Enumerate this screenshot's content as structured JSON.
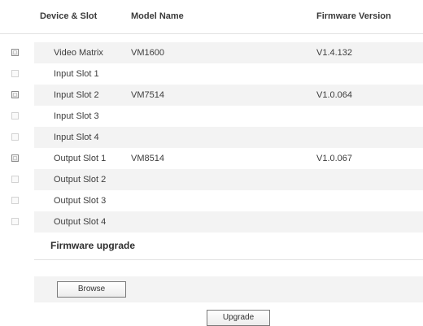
{
  "table": {
    "headers": {
      "device_slot": "Device & Slot",
      "model_name": "Model Name",
      "firmware_version": "Firmware Version"
    },
    "rows": [
      {
        "device": "Video Matrix",
        "model": "VM1600",
        "firmware": "V1.4.132",
        "checkbox_enabled": true
      },
      {
        "device": "Input Slot 1",
        "model": "",
        "firmware": "",
        "checkbox_enabled": false
      },
      {
        "device": "Input Slot 2",
        "model": "VM7514",
        "firmware": "V1.0.064",
        "checkbox_enabled": true
      },
      {
        "device": "Input Slot 3",
        "model": "",
        "firmware": "",
        "checkbox_enabled": false
      },
      {
        "device": "Input Slot 4",
        "model": "",
        "firmware": "",
        "checkbox_enabled": false
      },
      {
        "device": "Output Slot 1",
        "model": "VM8514",
        "firmware": "V1.0.067",
        "checkbox_enabled": true
      },
      {
        "device": "Output Slot 2",
        "model": "",
        "firmware": "",
        "checkbox_enabled": false
      },
      {
        "device": "Output Slot 3",
        "model": "",
        "firmware": "",
        "checkbox_enabled": false
      },
      {
        "device": "Output Slot 4",
        "model": "",
        "firmware": "",
        "checkbox_enabled": false
      }
    ]
  },
  "firmware_upgrade": {
    "title": "Firmware upgrade",
    "browse_label": "Browse",
    "upgrade_label": "Upgrade"
  },
  "colors": {
    "stripe": "#f3f3f3",
    "divider": "#e2e2e2",
    "text": "#333333",
    "button_border": "#7a7a7a"
  }
}
